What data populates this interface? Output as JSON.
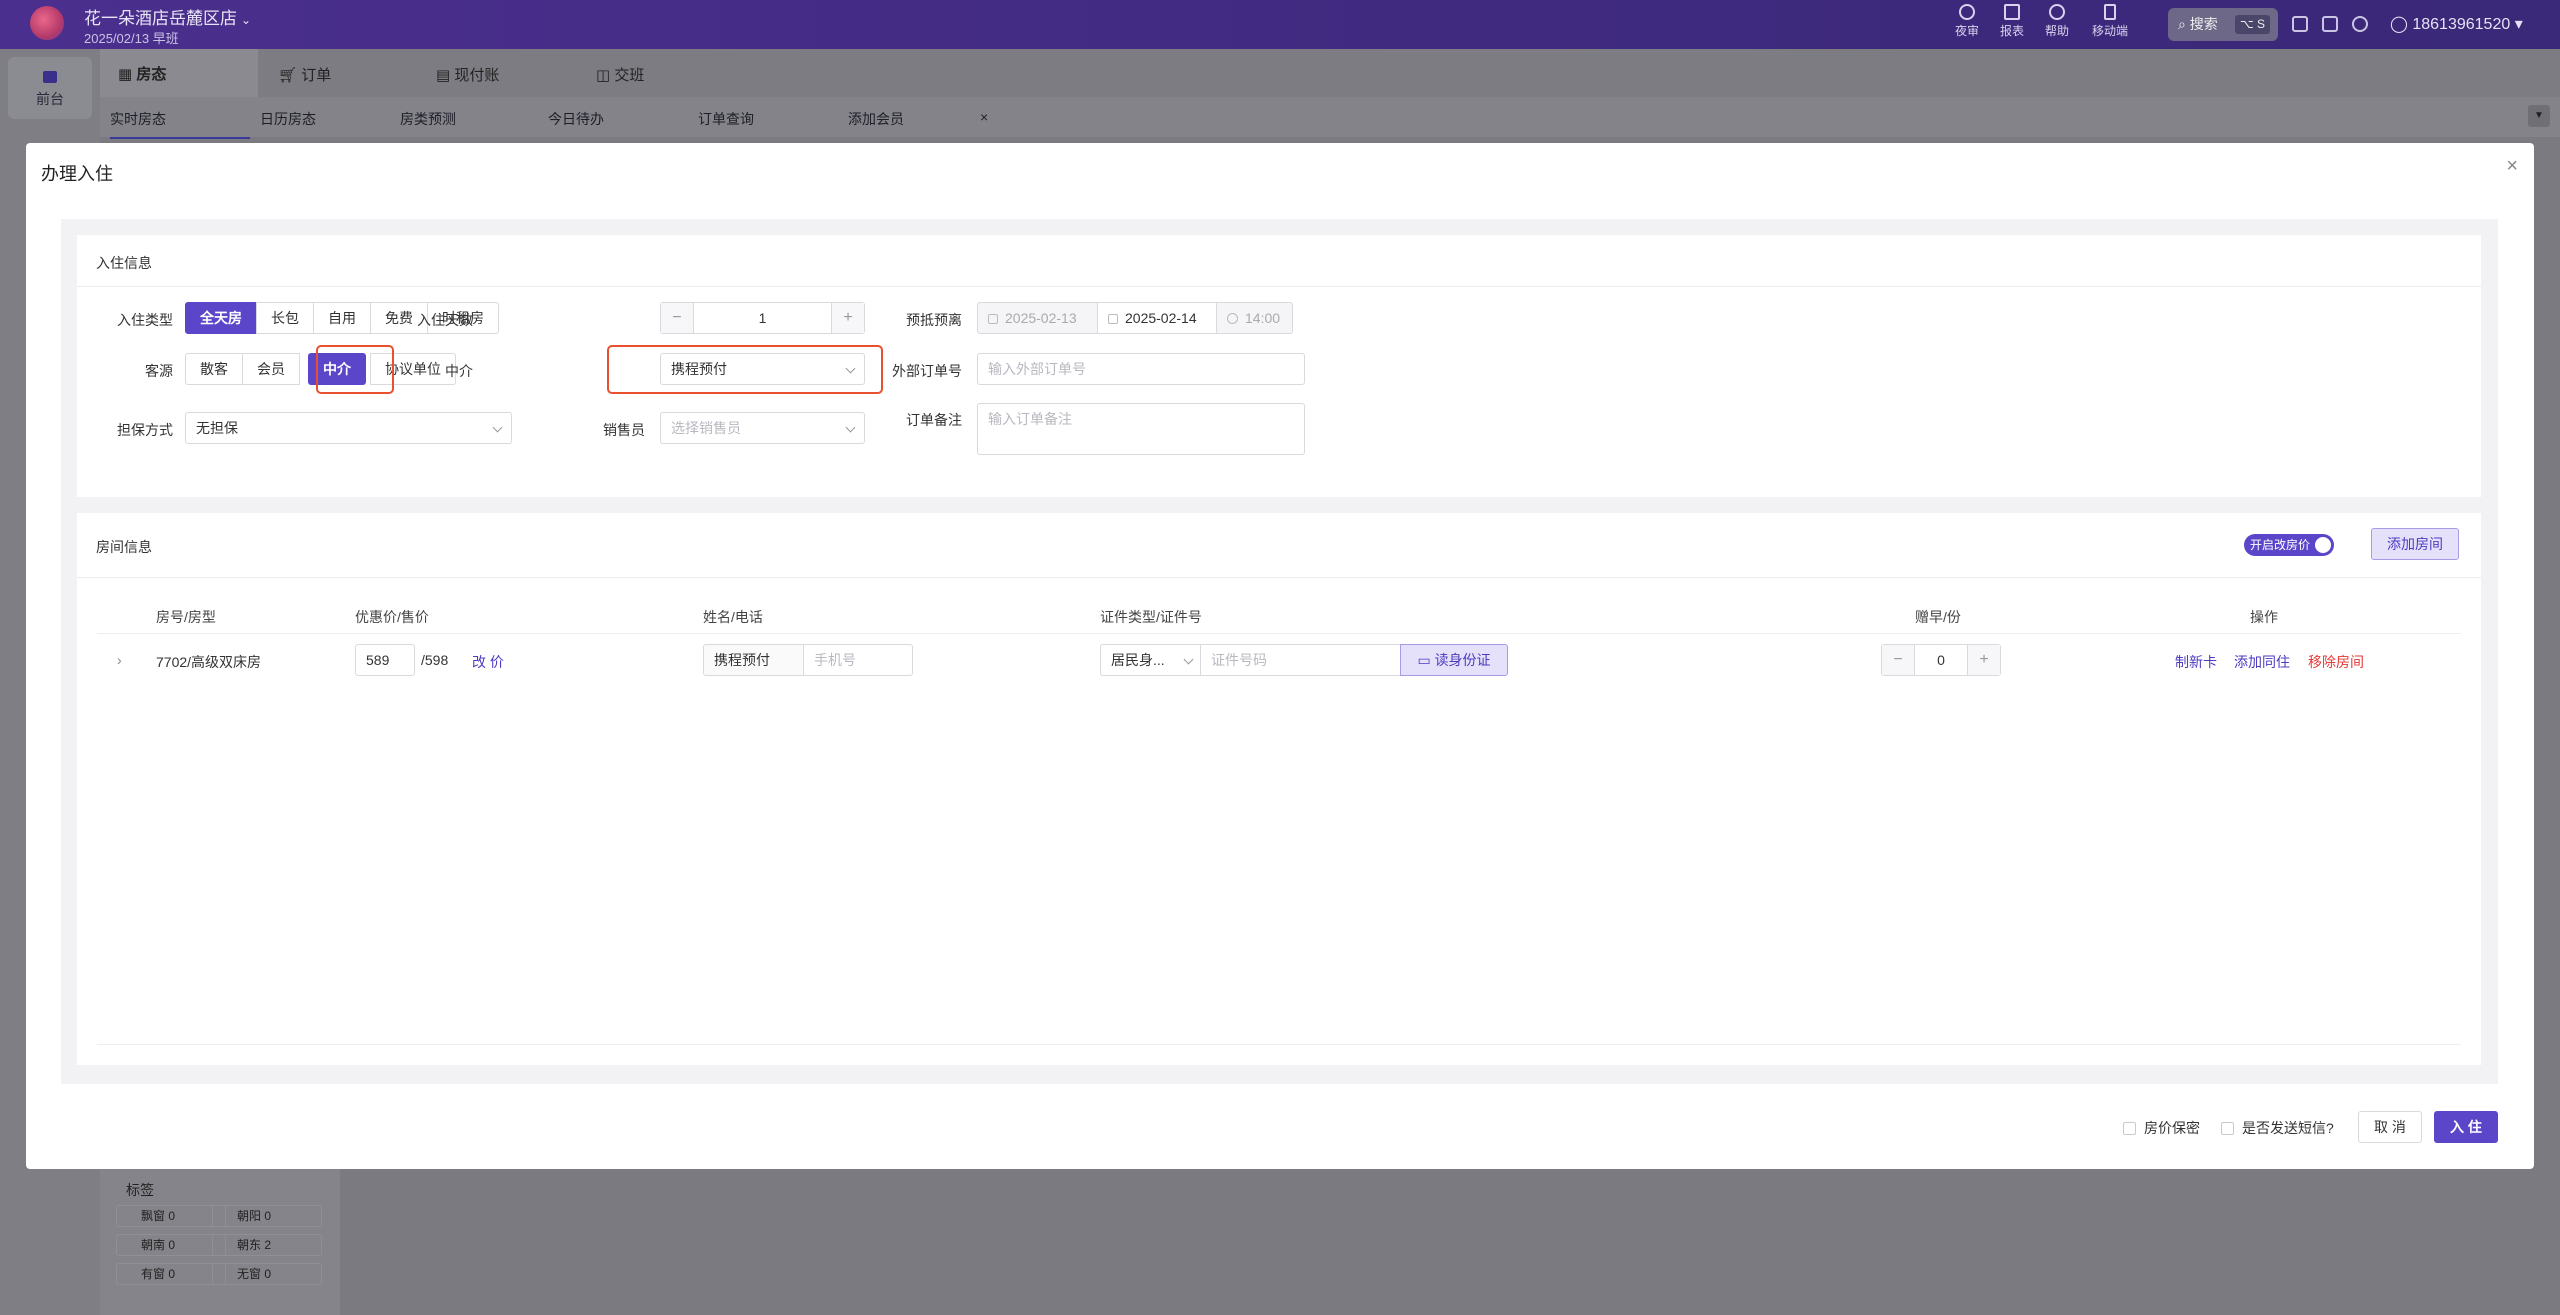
{
  "topbar": {
    "store_name": "花一朵酒店岳麓区店",
    "date_shift": "2025/02/13  早班",
    "tools": [
      "夜审",
      "报表",
      "帮助",
      "移动端"
    ],
    "search_label": "搜索",
    "search_kbd": "⌥ S",
    "user": "18613961520"
  },
  "sidebar": {
    "front_desk": "前台"
  },
  "nav": {
    "tabs": [
      "房态",
      "订单",
      "现付账",
      "交班"
    ]
  },
  "subtabs": [
    "实时房态",
    "日历房态",
    "房类预测",
    "今日待办",
    "订单查询",
    "添加会员"
  ],
  "bg_tags": {
    "title": "标签",
    "items": [
      "飘窗 0",
      "朝阳 0",
      "朝南 0",
      "朝东 2",
      "有窗 0",
      "无窗 0"
    ]
  },
  "modal": {
    "title": "办理入住",
    "close": "×",
    "checkin": {
      "section_title": "入住信息",
      "type_label": "入住类型",
      "types": [
        "全天房",
        "长包",
        "自用",
        "免费",
        "时租房"
      ],
      "type_selected": "全天房",
      "days_label": "入住天数",
      "days_value": "1",
      "arrive_leave_label": "预抵预离",
      "arrive_date": "2025-02-13",
      "leave_date": "2025-02-14",
      "leave_time": "14:00",
      "source_label": "客源",
      "sources": [
        "散客",
        "会员",
        "中介",
        "协议单位"
      ],
      "source_selected": "中介",
      "agent_label": "中介",
      "agent_value": "携程预付",
      "ext_order_label": "外部订单号",
      "ext_order_placeholder": "输入外部订单号",
      "guarantee_label": "担保方式",
      "guarantee_value": "无担保",
      "sales_label": "销售员",
      "sales_placeholder": "选择销售员",
      "remark_label": "订单备注",
      "remark_placeholder": "输入订单备注"
    },
    "rooms": {
      "section_title": "房间信息",
      "price_toggle": "开启改房价",
      "add_room": "添加房间",
      "columns": [
        "房号/房型",
        "优惠价/售价",
        "姓名/电话",
        "证件类型/证件号",
        "赠早/份",
        "操作"
      ],
      "row": {
        "room": "7702/高级双床房",
        "discount_price": "589",
        "sale_price": "/598",
        "change_price": "改 价",
        "name": "携程预付",
        "phone_placeholder": "手机号",
        "id_type": "居民身...",
        "id_placeholder": "证件号码",
        "read_id": "读身份证",
        "breakfast": "0",
        "actions": [
          "制新卡",
          "添加同住",
          "移除房间"
        ]
      }
    },
    "footer": {
      "price_secret": "房价保密",
      "send_sms": "是否发送短信?",
      "cancel": "取 消",
      "confirm": "入 住"
    }
  },
  "colors": {
    "primary": "#5b46c9",
    "highlight": "#e8502f",
    "danger": "#e53935"
  }
}
